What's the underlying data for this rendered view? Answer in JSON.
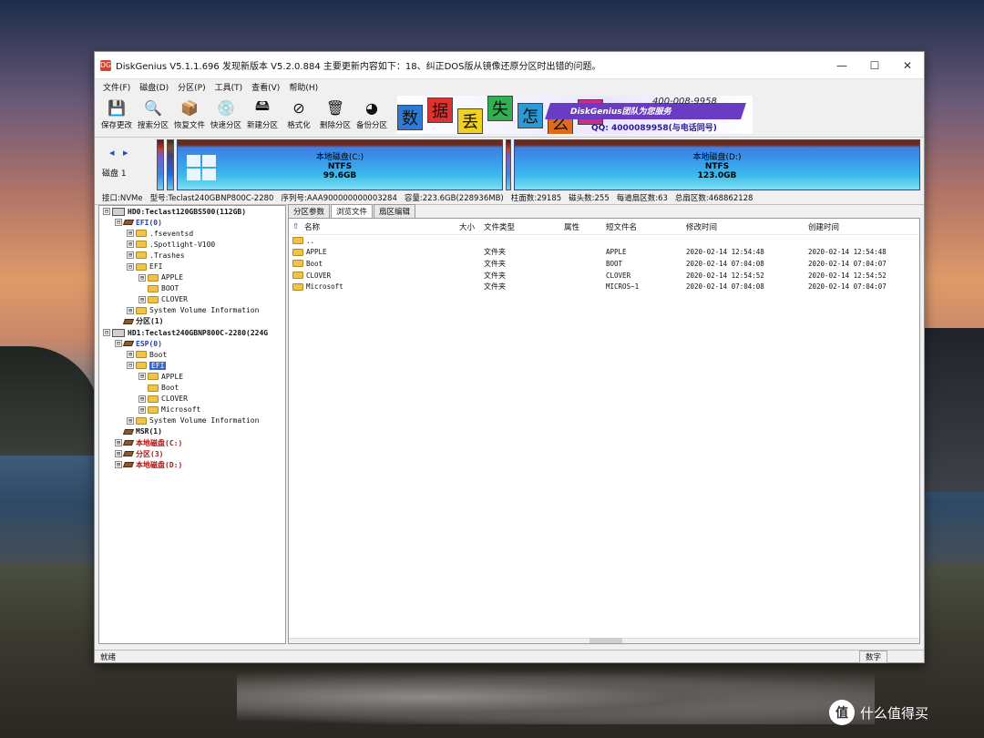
{
  "window": {
    "title": "DiskGenius V5.1.1.696  发现新版本 V5.2.0.884 主要更新内容如下：18、纠正DOS版从镜像还原分区时出错的问题。",
    "icon": "disk-genius-app-icon",
    "icon_text": "DG"
  },
  "menu": [
    "文件(F)",
    "磁盘(D)",
    "分区(P)",
    "工具(T)",
    "查看(V)",
    "帮助(H)"
  ],
  "toolbar": [
    {
      "label": "保存更改",
      "icon": "floppy-save-icon",
      "glyph": "💾"
    },
    {
      "label": "搜索分区",
      "icon": "magnifier-icon",
      "glyph": "🔍"
    },
    {
      "label": "恢复文件",
      "icon": "recover-box-icon",
      "glyph": "📦"
    },
    {
      "label": "快速分区",
      "icon": "disk-quick-icon",
      "glyph": "💿"
    },
    {
      "label": "新建分区",
      "icon": "new-partition-icon",
      "glyph": "🖴"
    },
    {
      "label": "格式化",
      "icon": "format-icon",
      "glyph": "⊘"
    },
    {
      "label": "删除分区",
      "icon": "trash-icon",
      "glyph": "🗑"
    },
    {
      "label": "备份分区",
      "icon": "backup-icon",
      "glyph": "◕"
    }
  ],
  "banner": {
    "chars": [
      "数",
      "据",
      "丢",
      "失",
      "怎",
      "么",
      "办"
    ],
    "line1": "DiskGenius团队为您服务",
    "phone": "400-008-9958",
    "qq": "QQ: 4000089958(与电话同号)"
  },
  "diskmap": {
    "nav": "◂ ▸",
    "disk_label": "磁盘 1",
    "partitions": [
      {
        "name": "本地磁盘(C:)",
        "fs": "NTFS",
        "size": "99.6GB"
      },
      {
        "name": "本地磁盘(D:)",
        "fs": "NTFS",
        "size": "123.0GB"
      }
    ]
  },
  "info": [
    "接口:NVMe",
    "型号:Teclast240GBNP800C-2280",
    "序列号:AAA900000000003284",
    "容量:223.6GB(228936MB)",
    "柱面数:29185",
    "磁头数:255",
    "每道扇区数:63",
    "总扇区数:468862128"
  ],
  "tree": [
    {
      "level": 0,
      "exp": "⊟",
      "type": "disk",
      "text": "HD0:Teclast120GBS500(112GB)",
      "style": "bold"
    },
    {
      "level": 1,
      "exp": "⊟",
      "type": "part",
      "text": "EFI(0)",
      "style": "blue"
    },
    {
      "level": 2,
      "exp": "⊞",
      "type": "folder",
      "text": ".fseventsd"
    },
    {
      "level": 2,
      "exp": "⊞",
      "type": "folder",
      "text": ".Spotlight-V100"
    },
    {
      "level": 2,
      "exp": "⊞",
      "type": "folder",
      "text": ".Trashes"
    },
    {
      "level": 2,
      "exp": "⊟",
      "type": "folder",
      "text": "EFI"
    },
    {
      "level": 3,
      "exp": "⊞",
      "type": "folder",
      "text": "APPLE"
    },
    {
      "level": 3,
      "exp": "",
      "type": "folder",
      "text": "BOOT"
    },
    {
      "level": 3,
      "exp": "⊞",
      "type": "folder",
      "text": "CLOVER"
    },
    {
      "level": 2,
      "exp": "⊞",
      "type": "folder",
      "text": "System Volume Information"
    },
    {
      "level": 1,
      "exp": "",
      "type": "part",
      "text": "分区(1)",
      "style": "bold"
    },
    {
      "level": 0,
      "exp": "⊟",
      "type": "disk",
      "text": "HD1:Teclast240GBNP800C-2280(224G",
      "style": "bold"
    },
    {
      "level": 1,
      "exp": "⊟",
      "type": "part",
      "text": "ESP(0)",
      "style": "blue"
    },
    {
      "level": 2,
      "exp": "⊞",
      "type": "folder",
      "text": "Boot"
    },
    {
      "level": 2,
      "exp": "⊟",
      "type": "folder",
      "text": "EFI",
      "style": "selected"
    },
    {
      "level": 3,
      "exp": "⊞",
      "type": "folder",
      "text": "APPLE"
    },
    {
      "level": 3,
      "exp": "",
      "type": "folder",
      "text": "Boot"
    },
    {
      "level": 3,
      "exp": "⊞",
      "type": "folder",
      "text": "CLOVER"
    },
    {
      "level": 3,
      "exp": "⊞",
      "type": "folder",
      "text": "Microsoft"
    },
    {
      "level": 2,
      "exp": "⊞",
      "type": "folder",
      "text": "System Volume Information"
    },
    {
      "level": 1,
      "exp": "",
      "type": "part",
      "text": "MSR(1)",
      "style": "bold"
    },
    {
      "level": 1,
      "exp": "⊞",
      "type": "part",
      "text": "本地磁盘(C:)",
      "style": "red"
    },
    {
      "level": 1,
      "exp": "⊞",
      "type": "part",
      "text": "分区(3)",
      "style": "red"
    },
    {
      "level": 1,
      "exp": "⊞",
      "type": "part",
      "text": "本地磁盘(D:)",
      "style": "red"
    }
  ],
  "tabs": [
    "分区参数",
    "浏览文件",
    "扇区编辑"
  ],
  "active_tab": 1,
  "columns": {
    "name": "名称",
    "size": "大小",
    "type": "文件类型",
    "attr": "属性",
    "short": "短文件名",
    "modified": "修改时间",
    "created": "创建时间"
  },
  "files": [
    {
      "name": "..",
      "size": "",
      "type": "",
      "attr": "",
      "short": "",
      "modified": "",
      "created": ""
    },
    {
      "name": "APPLE",
      "size": "",
      "type": "文件夹",
      "attr": "",
      "short": "APPLE",
      "modified": "2020-02-14 12:54:48",
      "created": "2020-02-14 12:54:48"
    },
    {
      "name": "Boot",
      "size": "",
      "type": "文件夹",
      "attr": "",
      "short": "BOOT",
      "modified": "2020-02-14 07:04:08",
      "created": "2020-02-14 07:04:07"
    },
    {
      "name": "CLOVER",
      "size": "",
      "type": "文件夹",
      "attr": "",
      "short": "CLOVER",
      "modified": "2020-02-14 12:54:52",
      "created": "2020-02-14 12:54:52"
    },
    {
      "name": "Microsoft",
      "size": "",
      "type": "文件夹",
      "attr": "",
      "short": "MICROS~1",
      "modified": "2020-02-14 07:04:08",
      "created": "2020-02-14 07:04:07"
    }
  ],
  "status": {
    "left": "就绪",
    "right": "数字"
  },
  "watermark": {
    "logo": "值",
    "text": "什么值得买"
  }
}
